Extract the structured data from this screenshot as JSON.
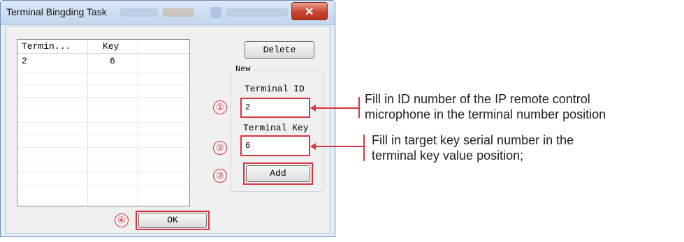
{
  "window": {
    "title": "Terminal Bingding Task",
    "close_label": "✕"
  },
  "table": {
    "headers": [
      "Termin...",
      "Key"
    ],
    "rows": [
      {
        "terminal": "2",
        "key": "6"
      }
    ]
  },
  "buttons": {
    "delete": "Delete",
    "add": "Add",
    "ok": "OK"
  },
  "new_group": {
    "label": "New",
    "terminal_id_label": "Terminal ID",
    "terminal_id_value": "2",
    "terminal_key_label": "Terminal Key",
    "terminal_key_value": "6"
  },
  "markers": [
    "①",
    "②",
    "③",
    "④"
  ],
  "annotations": {
    "id_note_line1": "Fill in ID number of the IP remote control",
    "id_note_line2": "microphone in the terminal number position",
    "key_note_line1": "Fill in target key serial number in the",
    "key_note_line2": "terminal key value position;"
  },
  "colors": {
    "highlight": "#d9363e",
    "title_bar": "#c2d6ee",
    "dialog_bg": "#f0f0f0"
  }
}
